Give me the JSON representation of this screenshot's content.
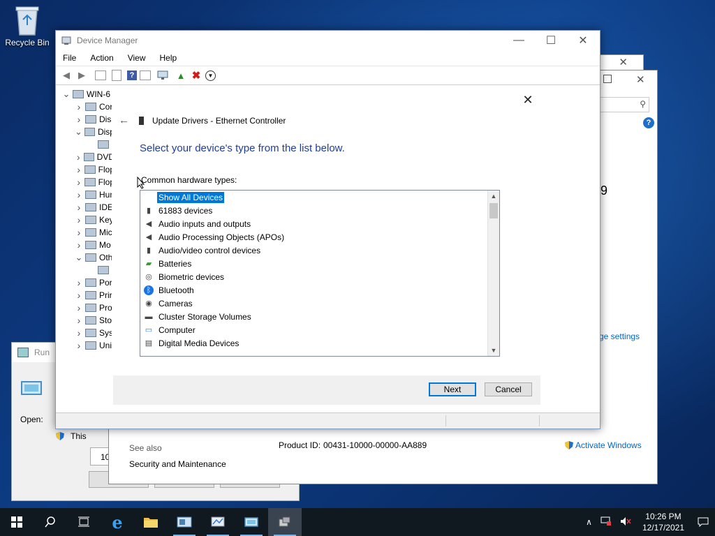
{
  "desktop": {
    "recycle_bin_label": "Recycle Bin"
  },
  "run_dialog": {
    "title": "Run",
    "open_label": "Open:",
    "info_text": "This",
    "partial_text": "10"
  },
  "system_window": {
    "see_also": "See also",
    "security_link": "Security and Maintenance",
    "product_id_label": "Product ID:",
    "product_id_value": "00431-10000-00000-AA889",
    "activate_link": "Activate Windows",
    "change_settings_link": "ge settings",
    "partial_number": "9"
  },
  "device_manager": {
    "title": "Device Manager",
    "menu": [
      "File",
      "Action",
      "View",
      "Help"
    ],
    "tree": [
      {
        "label": "WIN-6",
        "expand": "open",
        "indent": 0
      },
      {
        "label": "Cor",
        "expand": "closed",
        "indent": 1
      },
      {
        "label": "Disl",
        "expand": "closed",
        "indent": 1
      },
      {
        "label": "Disp",
        "expand": "open",
        "indent": 1
      },
      {
        "label": "",
        "expand": "none",
        "indent": 2
      },
      {
        "label": "DVD",
        "expand": "closed",
        "indent": 1
      },
      {
        "label": "Flop",
        "expand": "closed",
        "indent": 1
      },
      {
        "label": "Flop",
        "expand": "closed",
        "indent": 1
      },
      {
        "label": "Hun",
        "expand": "closed",
        "indent": 1
      },
      {
        "label": "IDE",
        "expand": "closed",
        "indent": 1
      },
      {
        "label": "Key",
        "expand": "closed",
        "indent": 1
      },
      {
        "label": "Mic",
        "expand": "closed",
        "indent": 1
      },
      {
        "label": "Mo",
        "expand": "closed",
        "indent": 1
      },
      {
        "label": "Oth",
        "expand": "open",
        "indent": 1
      },
      {
        "label": "",
        "expand": "none",
        "indent": 2
      },
      {
        "label": "Por",
        "expand": "closed",
        "indent": 1
      },
      {
        "label": "Prir",
        "expand": "closed",
        "indent": 1
      },
      {
        "label": "Pro",
        "expand": "closed",
        "indent": 1
      },
      {
        "label": "Sto",
        "expand": "closed",
        "indent": 1
      },
      {
        "label": "Sys",
        "expand": "closed",
        "indent": 1
      },
      {
        "label": "Uni",
        "expand": "closed",
        "indent": 1
      }
    ]
  },
  "wizard": {
    "header": "Update Drivers - Ethernet Controller",
    "heading": "Select your device's type from the list below.",
    "sub_label": "Common hardware types:",
    "items": [
      {
        "label": "Show All Devices",
        "icon": "none",
        "selected": true
      },
      {
        "label": "61883 devices",
        "icon": "plug-icon",
        "selected": false
      },
      {
        "label": "Audio inputs and outputs",
        "icon": "speaker-icon",
        "selected": false
      },
      {
        "label": "Audio Processing Objects (APOs)",
        "icon": "speaker-icon",
        "selected": false
      },
      {
        "label": "Audio/video control devices",
        "icon": "plug-icon",
        "selected": false
      },
      {
        "label": "Batteries",
        "icon": "battery-icon",
        "selected": false
      },
      {
        "label": "Biometric devices",
        "icon": "fingerprint-icon",
        "selected": false
      },
      {
        "label": "Bluetooth",
        "icon": "bluetooth-icon",
        "selected": false
      },
      {
        "label": "Cameras",
        "icon": "camera-icon",
        "selected": false
      },
      {
        "label": "Cluster Storage Volumes",
        "icon": "drive-icon",
        "selected": false
      },
      {
        "label": "Computer",
        "icon": "monitor-icon",
        "selected": false
      },
      {
        "label": "Digital Media Devices",
        "icon": "media-icon",
        "selected": false
      }
    ],
    "next_label": "Next",
    "cancel_label": "Cancel"
  },
  "taskbar": {
    "time": "10:26 PM",
    "date": "12/17/2021"
  }
}
